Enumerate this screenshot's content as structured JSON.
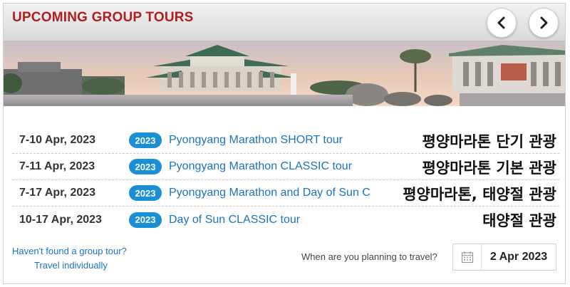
{
  "header": {
    "title": "UPCOMING GROUP TOURS",
    "title_color": "#b01f1f",
    "prev_icon": "chevron-left-icon",
    "next_icon": "chevron-right-icon"
  },
  "tours": [
    {
      "dates": "7-10 Apr, 2023",
      "year": "2023",
      "name": "Pyongyang Marathon SHORT tour",
      "korean": "평양마라톤 단기 관광"
    },
    {
      "dates": "7-11 Apr, 2023",
      "year": "2023",
      "name": "Pyongyang Marathon CLASSIC tour",
      "korean": "평양마라톤 기본 관광"
    },
    {
      "dates": "7-17 Apr, 2023",
      "year": "2023",
      "name": "Pyongyang Marathon and Day of Sun C",
      "korean": "평양마라톤, 태양절 관광"
    },
    {
      "dates": "10-17 Apr, 2023",
      "year": "2023",
      "name": "Day of Sun CLASSIC tour",
      "korean": "태양절 관광"
    }
  ],
  "footer": {
    "not_found": "Haven't found a group tour?",
    "travel_individually": "Travel individually",
    "plan_label": "When are you planning to travel?",
    "date_value": "2 Apr 2023",
    "calendar_icon": "calendar-icon"
  },
  "colors": {
    "badge": "#1a8fd6",
    "link": "#1a73c2"
  }
}
